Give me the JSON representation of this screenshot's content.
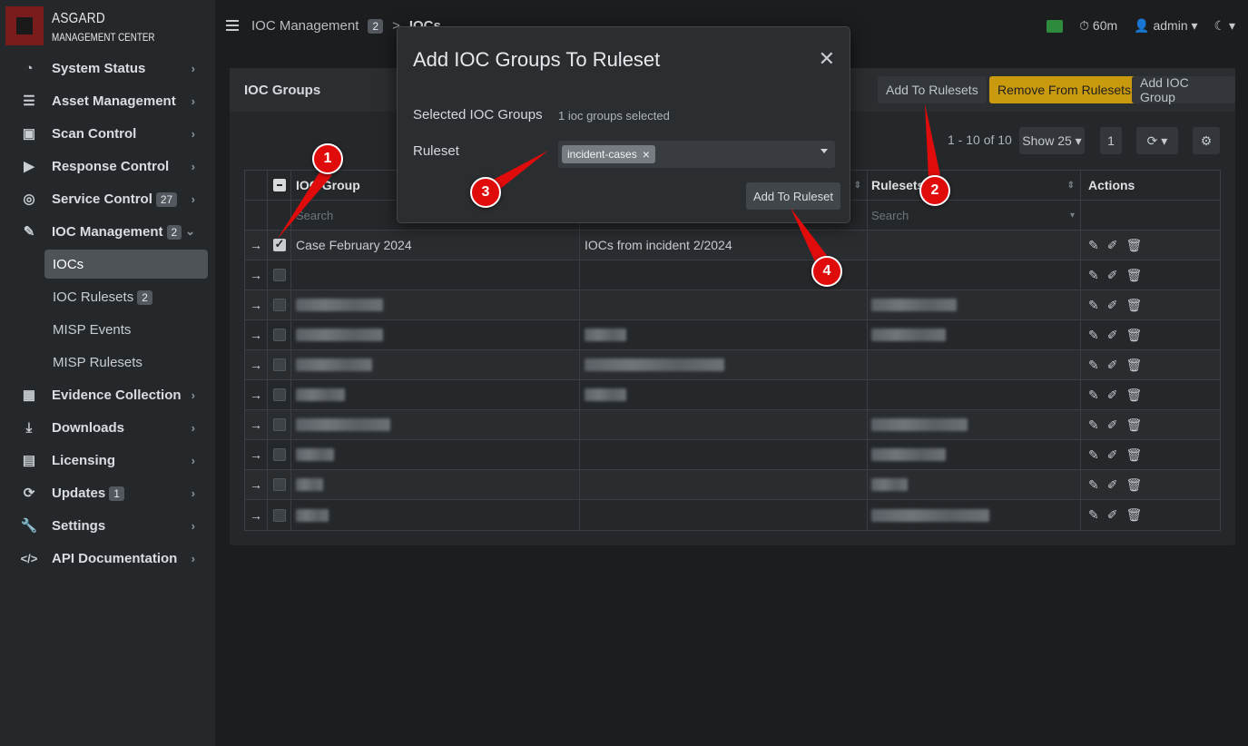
{
  "brand": {
    "line1": "ASGARD",
    "line2": "MANAGEMENT CENTER"
  },
  "sidebar": {
    "items": [
      {
        "label": "System Status",
        "icon": "gauge-icon"
      },
      {
        "label": "Asset Management",
        "icon": "server-icon"
      },
      {
        "label": "Scan Control",
        "icon": "scan-icon"
      },
      {
        "label": "Response Control",
        "icon": "play-icon"
      },
      {
        "label": "Service Control",
        "icon": "target-icon",
        "badge": "27"
      },
      {
        "label": "IOC Management",
        "icon": "ioc-icon",
        "badge": "2"
      }
    ],
    "sub_items": [
      {
        "label": "IOCs"
      },
      {
        "label": "IOC Rulesets",
        "badge": "2"
      },
      {
        "label": "MISP Events"
      },
      {
        "label": "MISP Rulesets"
      }
    ],
    "items2": [
      {
        "label": "Evidence Collection",
        "icon": "boxes-icon"
      },
      {
        "label": "Downloads",
        "icon": "download-icon"
      },
      {
        "label": "Licensing",
        "icon": "license-icon"
      },
      {
        "label": "Updates",
        "icon": "refresh-icon",
        "badge": "1"
      },
      {
        "label": "Settings",
        "icon": "wrench-icon"
      },
      {
        "label": "API Documentation",
        "icon": "code-icon"
      }
    ]
  },
  "topbar": {
    "breadcrumb": [
      "IOC Management",
      "IOCs"
    ],
    "breadcrumb_badge": "2",
    "timer": "60m",
    "user": "admin"
  },
  "panel": {
    "title": "IOC Groups",
    "buttons": {
      "add_to_rulesets": "Add To Rulesets",
      "remove_from_rulesets": "Remove From Rulesets",
      "add_ioc_group": "Add IOC Group"
    },
    "pagination": {
      "range": "1 - 10 of 10",
      "show": "Show 25",
      "page": "1"
    }
  },
  "table": {
    "columns": [
      "IOC Group",
      "",
      "Rulesets",
      "Actions"
    ],
    "search_placeholder": "Search",
    "rows": [
      {
        "group": "Case February 2024",
        "description": "IOCs from incident 2/2024",
        "checked": true
      }
    ]
  },
  "modal": {
    "title": "Add IOC Groups To Ruleset",
    "selected_label": "Selected IOC Groups",
    "selected_value": "1 ioc groups selected",
    "ruleset_label": "Ruleset",
    "tag": "incident-cases",
    "submit": "Add To Ruleset"
  },
  "markers": [
    "1",
    "2",
    "3",
    "4"
  ],
  "colors": {
    "warn": "#c99a0e",
    "marker": "#e00c0c",
    "active": "#4e5358"
  }
}
